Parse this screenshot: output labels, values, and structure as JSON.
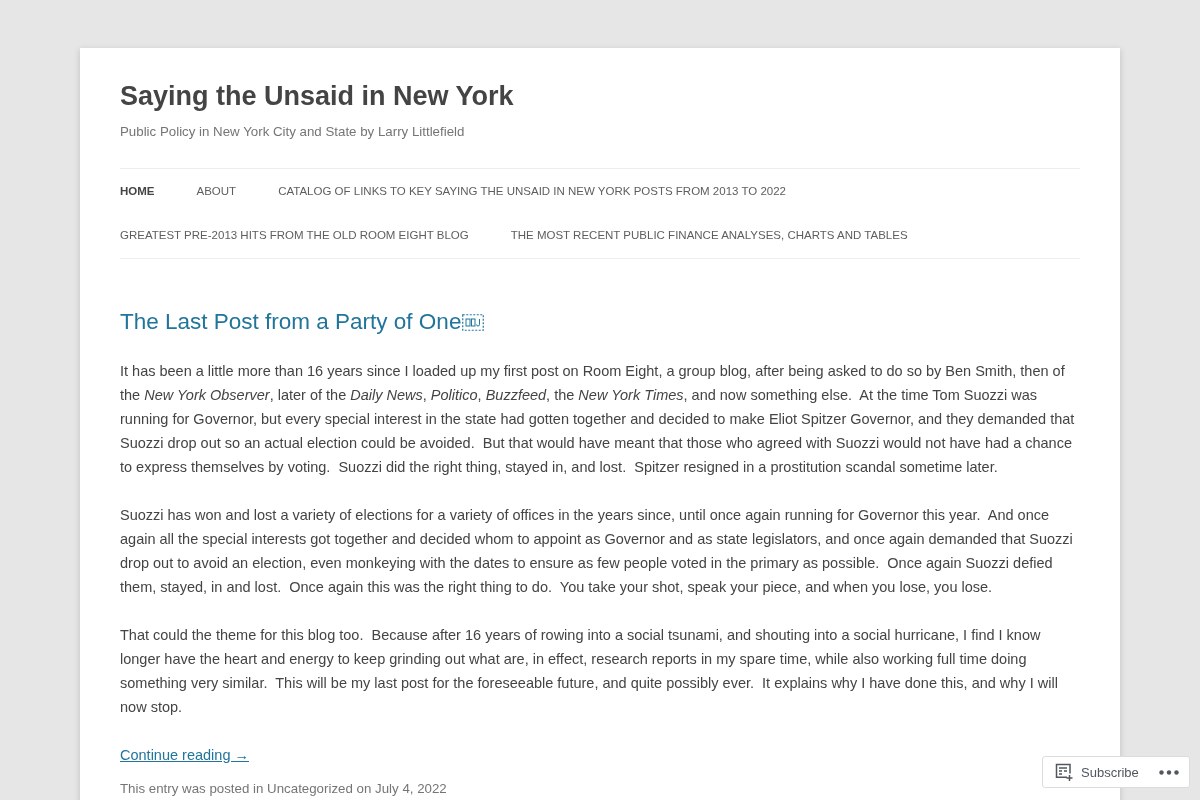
{
  "site": {
    "title": "Saying the Unsaid in New York",
    "tagline": "Public Policy in New York City and State by Larry Littlefield"
  },
  "nav": [
    {
      "label": "HOME",
      "selected": true
    },
    {
      "label": "ABOUT",
      "selected": false
    },
    {
      "label": "CATALOG OF LINKS TO KEY SAYING THE UNSAID IN NEW YORK POSTS FROM 2013 TO 2022",
      "selected": false
    },
    {
      "label": "GREATEST PRE-2013 HITS FROM THE OLD ROOM EIGHT BLOG",
      "selected": false
    },
    {
      "label": "THE MOST RECENT PUBLIC FINANCE ANALYSES, CHARTS AND TABLES",
      "selected": false
    }
  ],
  "post": {
    "title": "The Last Post from a Party of One",
    "paragraphs": [
      "It has been a little more than 16 years since I loaded up my first post on Room Eight, a group blog, after being asked to do so by Ben Smith, then of the *New York Observer*, later of the *Daily News*, *Politico*, *Buzzfeed*, the *New York Times*, and now something else.  At the time Tom Suozzi was running for Governor, but every special interest in the state had gotten together and decided to make Eliot Spitzer Governor, and they demanded that Suozzi drop out so an actual election could be avoided.  But that would have meant that those who agreed with Suozzi would not have had a chance to express themselves by voting.  Suozzi did the right thing, stayed in, and lost.  Spitzer resigned in a prostitution scandal sometime later.",
      "Suozzi has won and lost a variety of elections for a variety of offices in the years since, until once again running for Governor this year.  And once again all the special interests got together and decided whom to appoint as Governor and as state legislators, and once again demanded that Suozzi drop out to avoid an election, even monkeying with the dates to ensure as few people voted in the primary as possible.  Once again Suozzi defied them, stayed, in and lost.  Once again this was the right thing to do.  You take your shot, speak your piece, and when you lose, you lose.",
      "That could the theme for this blog too.  Because after 16 years of rowing into a social tsunami, and shouting into a social hurricane, I find I know longer have the heart and energy to keep grinding out what are, in effect, research reports in my spare time, while also working full time doing something very similar.  This will be my last post for the foreseeable future, and quite possibly ever.  It explains why I have done this, and why I will now stop."
    ],
    "continue_link": "Continue reading →",
    "meta": {
      "prefix": "This entry was posted in",
      "category": "Uncategorized",
      "joiner": "on",
      "date": "July 4, 2022"
    }
  },
  "subscribe_bar": {
    "label": "Subscribe"
  }
}
